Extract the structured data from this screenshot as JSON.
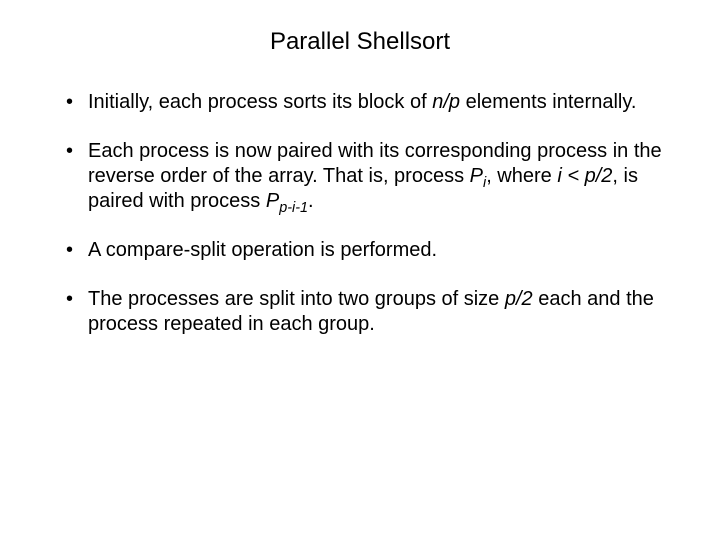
{
  "title": "Parallel Shellsort",
  "bullets": {
    "b1_a": "Initially, each process sorts its block of ",
    "b1_np": "n/p",
    "b1_b": " elements internally.",
    "b2_a": "Each process is now paired with its corresponding process in the reverse order of the array. That is, process ",
    "b2_P1": "P",
    "b2_sub1": "i",
    "b2_b": ", where ",
    "b2_cond": "i < p/2",
    "b2_c": ", is paired with process ",
    "b2_P2": "P",
    "b2_sub2": "p-i-1",
    "b2_d": ".",
    "b3": "A compare-split operation is performed.",
    "b4_a": "The processes are split into two groups of size ",
    "b4_p2": "p/2",
    "b4_b": " each and the process repeated in each group."
  }
}
